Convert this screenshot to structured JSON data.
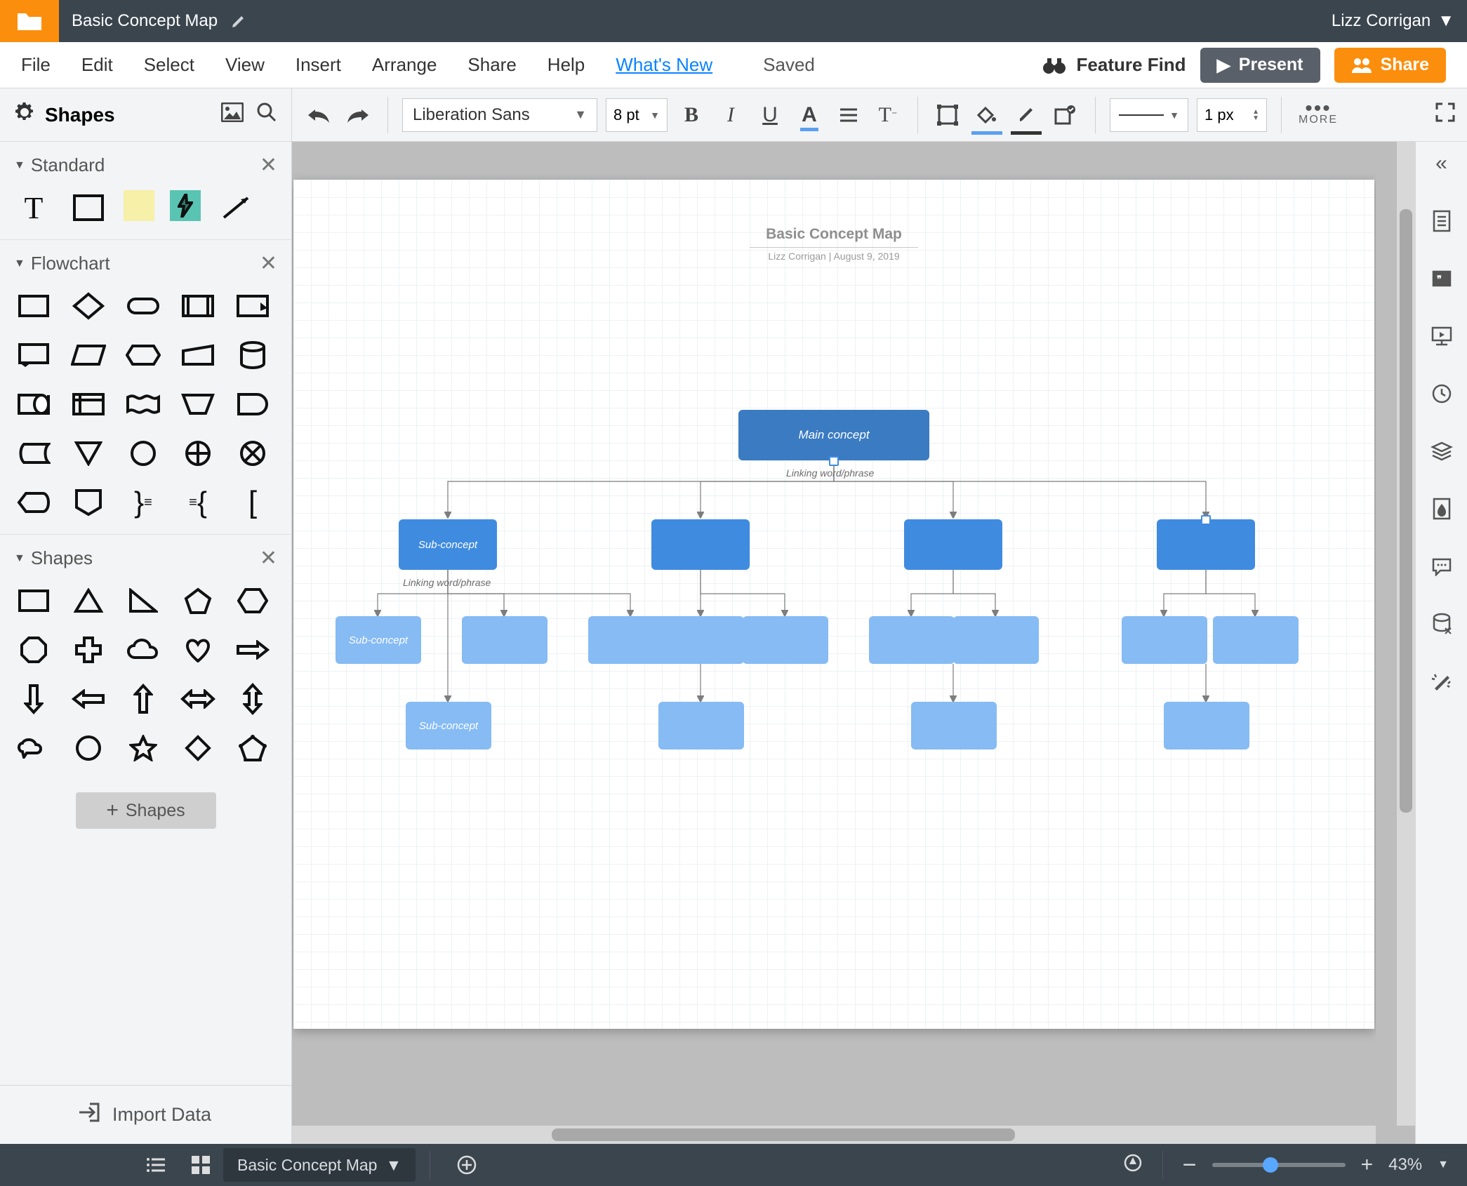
{
  "titlebar": {
    "document_name": "Basic Concept Map",
    "user_name": "Lizz Corrigan"
  },
  "menus": {
    "file": "File",
    "edit": "Edit",
    "select": "Select",
    "view": "View",
    "insert": "Insert",
    "arrange": "Arrange",
    "share": "Share",
    "help": "Help",
    "whatsnew": "What's New",
    "saved": "Saved",
    "feature_find": "Feature Find",
    "present": "Present",
    "share_btn": "Share"
  },
  "left_header": {
    "label": "Shapes"
  },
  "toolbar": {
    "font": "Liberation Sans",
    "font_size": "8 pt",
    "line_width": "1 px",
    "more_label": "MORE"
  },
  "categories": {
    "standard": "Standard",
    "flowchart": "Flowchart",
    "shapes": "Shapes",
    "add_shapes": "Shapes",
    "import_data": "Import Data"
  },
  "canvas": {
    "title": "Basic Concept Map",
    "subtitle": "Lizz Corrigan   |   August 9, 2019",
    "main_concept": "Main concept",
    "linking1": "Linking word/phrase",
    "sub_concept": "Sub-concept",
    "linking2": "Linking word/phrase",
    "sub_concept2": "Sub-concept",
    "sub_concept3": "Sub-concept"
  },
  "bottombar": {
    "tab_name": "Basic Concept Map",
    "zoom": "43%"
  }
}
